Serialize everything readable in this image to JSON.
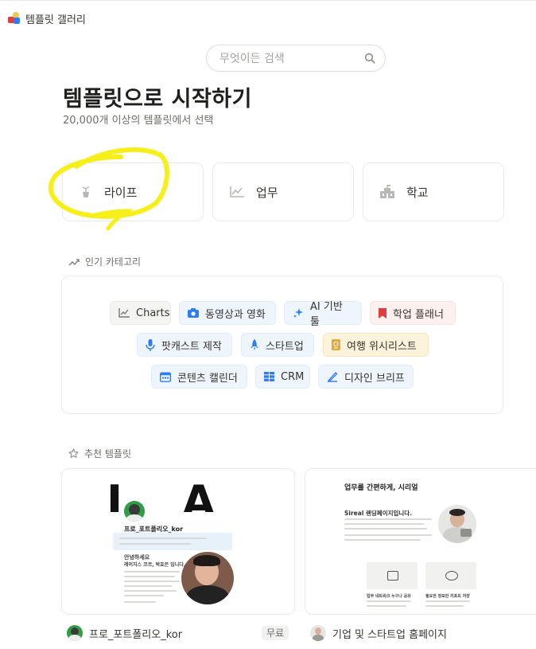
{
  "header": {
    "title": "템플릿 갤러리"
  },
  "search": {
    "placeholder": "무엇이든 검색"
  },
  "hero": {
    "title": "템플릿으로 시작하기",
    "subtitle": "20,000개 이상의 템플릿에서 선택"
  },
  "categories_main": [
    {
      "label": "라이프",
      "icon": "plant-icon"
    },
    {
      "label": "업무",
      "icon": "chart-icon"
    },
    {
      "label": "학교",
      "icon": "school-icon"
    }
  ],
  "popular": {
    "heading": "인기 카테고리",
    "chips": [
      {
        "label": "Charts",
        "icon": "chart-icon"
      },
      {
        "label": "동영상과 영화",
        "icon": "camera-icon"
      },
      {
        "label": "AI 기반 툴",
        "icon": "sparkle-icon"
      },
      {
        "label": "학업 플래너",
        "icon": "bookmark-icon"
      },
      {
        "label": "팟캐스트 제작",
        "icon": "microphone-icon"
      },
      {
        "label": "스타트업",
        "icon": "rocket-icon"
      },
      {
        "label": "여행 위시리스트",
        "icon": "passport-icon"
      },
      {
        "label": "콘텐츠 캘린더",
        "icon": "calendar-icon"
      },
      {
        "label": "CRM",
        "icon": "table-icon"
      },
      {
        "label": "디자인 브리프",
        "icon": "design-icon"
      }
    ]
  },
  "recommended": {
    "heading": "추천 템플릿",
    "templates": [
      {
        "name": "프로_포트폴리오_kor",
        "badge": "무료",
        "preview": {
          "banner": "I A M",
          "profile": "프로_포트폴리오_kor",
          "intro_heading": "안녕하세요",
          "intro_sub": "레이지스 코르, 박효은 입니다."
        }
      },
      {
        "name": "기업 및 스타트업 홈페이지",
        "preview": {
          "headline": "업무를 간편하게, 시리얼",
          "sub": "Sireal 랜딩페이지입니다.",
          "tile1": "업무 네트워크 누구나 공유",
          "tile2": "필요한 정보만 리포트 저장"
        }
      }
    ]
  },
  "colors": {
    "accent_yellow": "#f6ef1a",
    "brand_blue": "#2e7cf6"
  }
}
